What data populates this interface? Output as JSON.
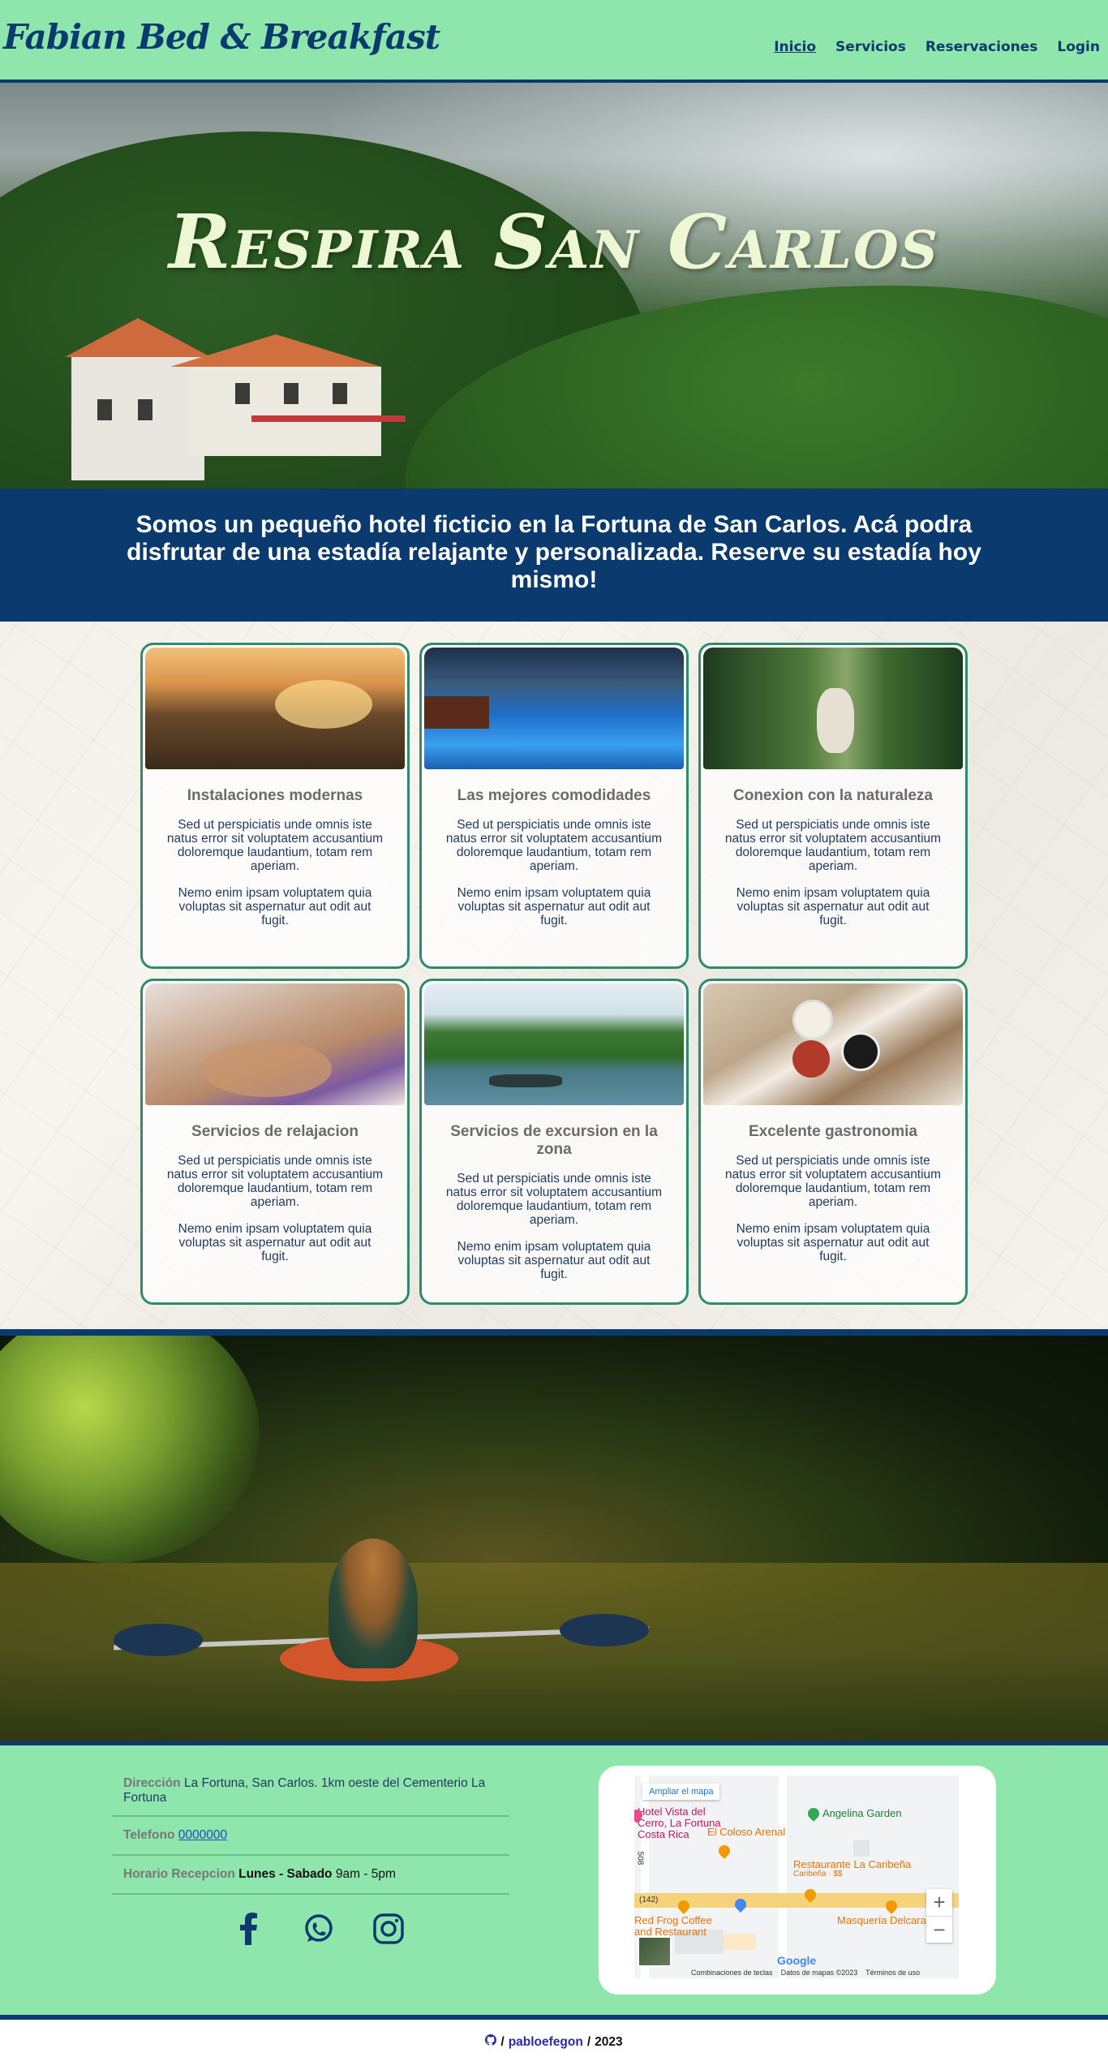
{
  "header": {
    "brand": "Fabian Bed & Breakfast",
    "nav": [
      {
        "label": "Inicio",
        "active": true
      },
      {
        "label": "Servicios"
      },
      {
        "label": "Reservaciones"
      },
      {
        "label": "Login"
      }
    ]
  },
  "hero": {
    "title": "Respira San Carlos"
  },
  "intro": {
    "text": "Somos un pequeño hotel ficticio en la Fortuna de San Carlos. Acá podra disfrutar de una estadía relajante y personalizada. Reserve su estadía hoy mismo!"
  },
  "features": [
    {
      "title": "Instalaciones modernas",
      "p1": "Sed ut perspiciatis unde omnis iste natus error sit voluptatem accusantium doloremque laudantium, totam rem aperiam.",
      "p2": "Nemo enim ipsam voluptatem quia voluptas sit aspernatur aut odit aut fugit."
    },
    {
      "title": "Las mejores comodidades",
      "p1": "Sed ut perspiciatis unde omnis iste natus error sit voluptatem accusantium doloremque laudantium, totam rem aperiam.",
      "p2": "Nemo enim ipsam voluptatem quia voluptas sit aspernatur aut odit aut fugit."
    },
    {
      "title": "Conexion con la naturaleza",
      "p1": "Sed ut perspiciatis unde omnis iste natus error sit voluptatem accusantium doloremque laudantium, totam rem aperiam.",
      "p2": "Nemo enim ipsam voluptatem quia voluptas sit aspernatur aut odit aut fugit."
    },
    {
      "title": "Servicios de relajacion",
      "p1": "Sed ut perspiciatis unde omnis iste natus error sit voluptatem accusantium doloremque laudantium, totam rem aperiam.",
      "p2": "Nemo enim ipsam voluptatem quia voluptas sit aspernatur aut odit aut fugit."
    },
    {
      "title": "Servicios de excursion en la zona",
      "p1": "Sed ut perspiciatis unde omnis iste natus error sit voluptatem accusantium doloremque laudantium, totam rem aperiam.",
      "p2": "Nemo enim ipsam voluptatem quia voluptas sit aspernatur aut odit aut fugit."
    },
    {
      "title": "Excelente gastronomia",
      "p1": "Sed ut perspiciatis unde omnis iste natus error sit voluptatem accusantium doloremque laudantium, totam rem aperiam.",
      "p2": "Nemo enim ipsam voluptatem quia voluptas sit aspernatur aut odit aut fugit."
    }
  ],
  "info": {
    "address_label": "Dirección",
    "address_value": "La Fortuna, San Carlos. 1km oeste del Cementerio La Fortuna",
    "phone_label": "Telefono",
    "phone_value": "0000000",
    "hours_label": "Horario Recepcion",
    "hours_days": "Lunes - Sabado",
    "hours_value": "9am - 5pm",
    "social_icons": [
      "facebook-icon",
      "whatsapp-icon",
      "instagram-icon"
    ]
  },
  "map": {
    "enlarge": "Ampliar el mapa",
    "places": {
      "hotel": "Hotel Vista del Cerro, La Fortuna Costa Rica",
      "angelina": "Angelina Garden",
      "coloso": "El Coloso Arenal",
      "caribena": "Restaurante La Caribeña",
      "caribena_sub": "Caribeña · $$",
      "route": "(142)",
      "road_num": "508",
      "frog": "Red Frog Coffee and Restaurant",
      "masqueria": "Masquería Delcarajo"
    },
    "zoom_in": "+",
    "zoom_out": "−",
    "google": "Google",
    "shortcuts": "Combinaciones de teclas",
    "data": "Datos de mapas ©2023",
    "terms": "Términos de uso"
  },
  "credit": {
    "sep": "/",
    "author": "pabloefegon",
    "year": "2023"
  },
  "colors": {
    "header_bg": "#8fe6ac",
    "navy": "#0b3a6e",
    "card_border": "#2e8b6e"
  }
}
